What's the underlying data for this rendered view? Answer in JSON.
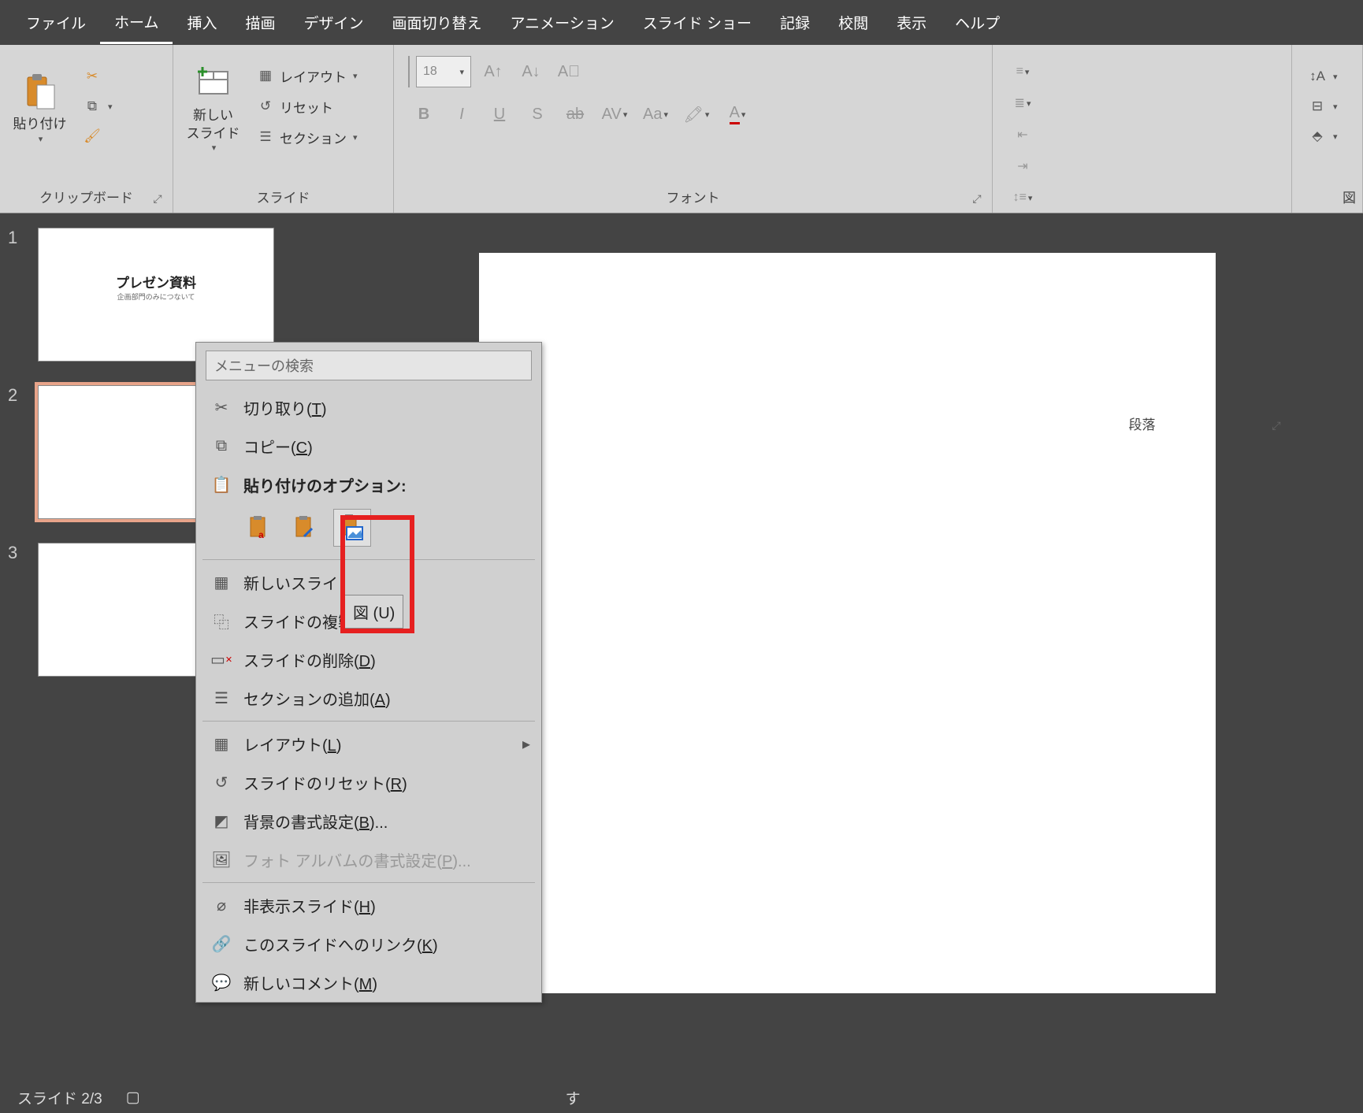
{
  "tabs": {
    "file": "ファイル",
    "home": "ホーム",
    "insert": "挿入",
    "draw": "描画",
    "design": "デザイン",
    "transitions": "画面切り替え",
    "animations": "アニメーション",
    "slideshow": "スライド ショー",
    "record": "記録",
    "review": "校閲",
    "view": "表示",
    "help": "ヘルプ"
  },
  "ribbon": {
    "clipboard": {
      "paste": "貼り付け",
      "label": "クリップボード"
    },
    "slides": {
      "new_slide": "新しい\nスライド",
      "layout": "レイアウト",
      "reset": "リセット",
      "section": "セクション",
      "label": "スライド"
    },
    "font": {
      "size_value": "18",
      "label": "フォント"
    },
    "paragraph": {
      "label": "段落"
    },
    "drawing_partial": "図"
  },
  "thumbs": {
    "n1": "1",
    "n2": "2",
    "n3": "3",
    "slide1_title": "プレゼン資料",
    "slide1_sub": "企画部門のみにつないて"
  },
  "context": {
    "search_placeholder": "メニューの検索",
    "cut": "切り取り(",
    "cut_key": "T",
    "copy": "コピー(",
    "copy_key": "C",
    "paste_options": "貼り付けのオプション:",
    "new_slide": "新しいスライ",
    "duplicate": "スライドの複製(",
    "duplicate_key": "A",
    "delete": "スライドの削除(",
    "delete_key": "D",
    "add_section": "セクションの追加(",
    "add_section_key": "A",
    "layout": "レイアウト(",
    "layout_key": "L",
    "reset": "スライドのリセット(",
    "reset_key": "R",
    "format_bg": "背景の書式設定(",
    "format_bg_key": "B",
    "format_bg_suffix": ")...",
    "photo_album": "フォト アルバムの書式設定(",
    "photo_album_key": "P",
    "photo_album_suffix": ")...",
    "hide_slide": "非表示スライド(",
    "hide_slide_key": "H",
    "link_to_slide": "このスライドへのリンク(",
    "link_to_slide_key": "K",
    "new_comment": "新しいコメント(",
    "new_comment_key": "M",
    "tooltip": "図 (U)",
    "close_paren": ")"
  },
  "status": {
    "slide_count": "スライド 2/3",
    "suffix": "す"
  }
}
